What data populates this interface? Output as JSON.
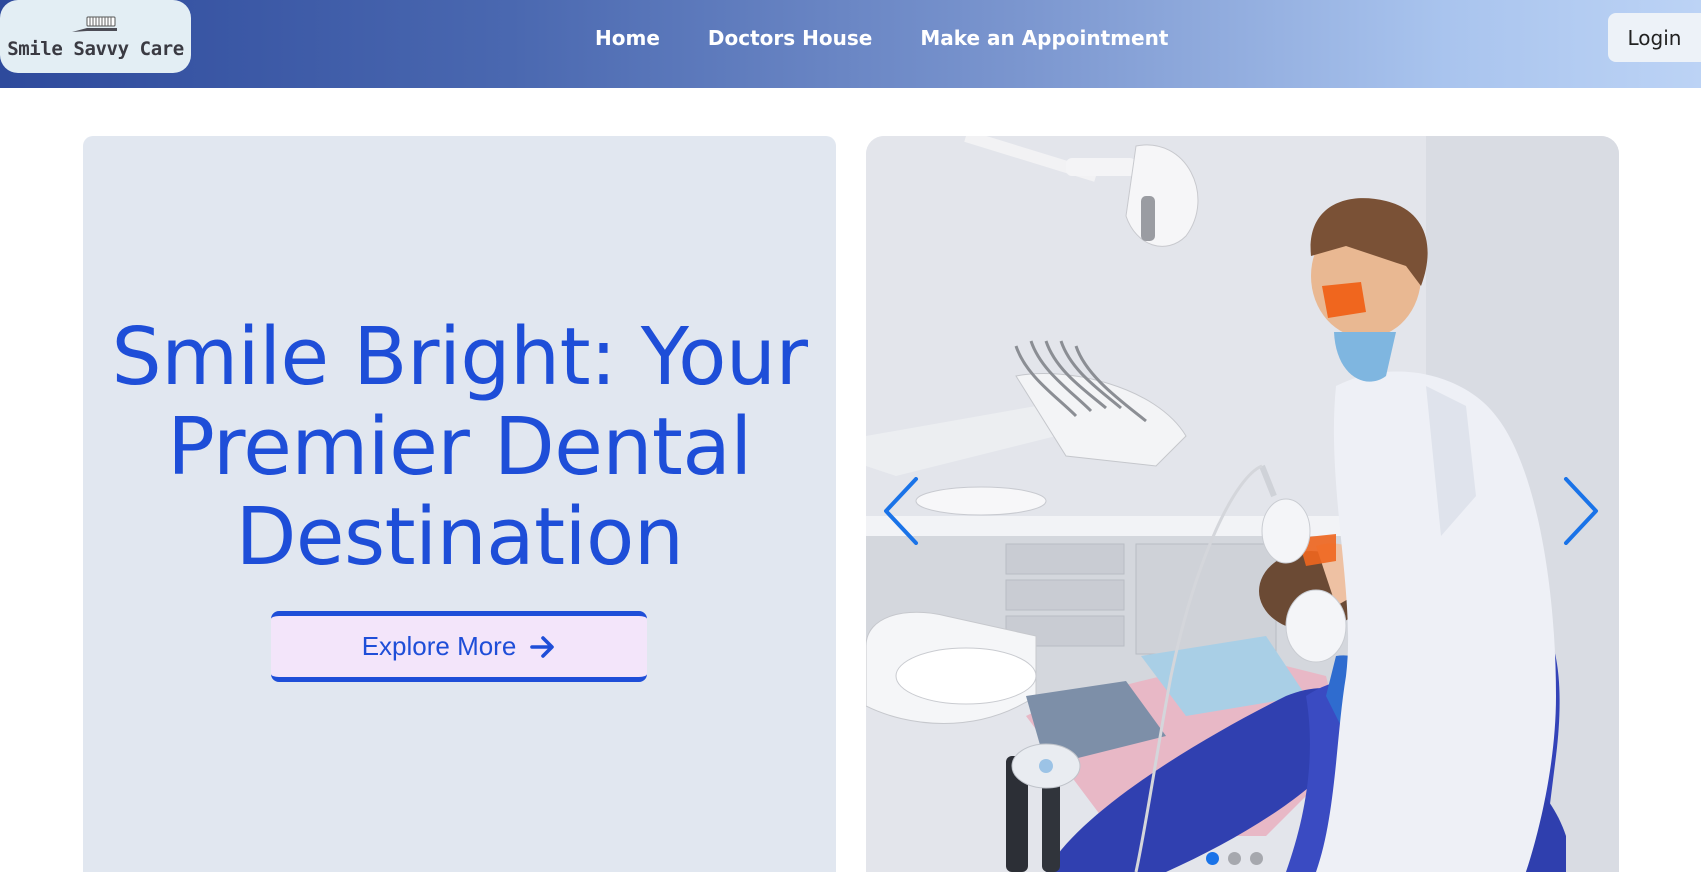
{
  "brand": {
    "name": "Smile Savvy Care",
    "icon": "toothbrush-icon"
  },
  "nav": {
    "items": [
      {
        "label": "Home"
      },
      {
        "label": "Doctors House"
      },
      {
        "label": "Make an Appointment"
      }
    ],
    "login_label": "Login"
  },
  "hero": {
    "title_lines": [
      "Smile Bright: Your",
      "Premier Dental",
      "Destination"
    ],
    "cta_label": "Explore More",
    "cta_icon": "arrow-right-icon"
  },
  "carousel": {
    "image": "dentist-treating-patient",
    "prev_icon": "chevron-left-icon",
    "next_icon": "chevron-right-icon",
    "slide_count": 3,
    "active_index": 0
  },
  "colors": {
    "accent": "#1e4ed8",
    "header_start": "#2e4a9c",
    "header_end": "#bcd3f5",
    "panel_bg": "#e1e7f0",
    "cta_bg": "#f3e5fa",
    "carousel_arrow": "#1a73e8"
  }
}
